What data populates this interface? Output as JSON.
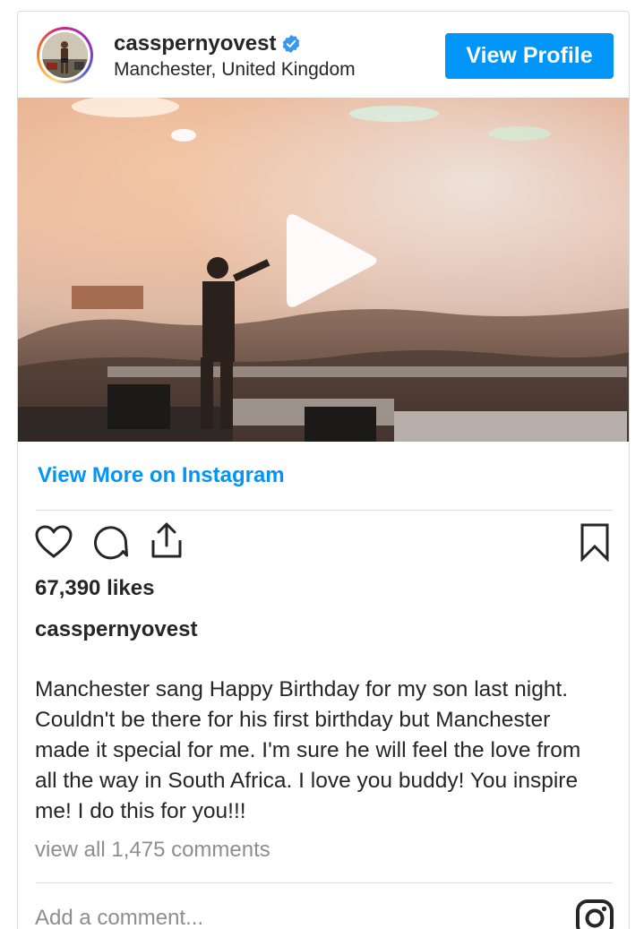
{
  "header": {
    "username": "casspernyovest",
    "verified": true,
    "location": "Manchester, United Kingdom",
    "view_profile_label": "View Profile"
  },
  "media": {
    "type": "video",
    "description_icon": "play-icon"
  },
  "view_more_label": "View More on Instagram",
  "actions": {
    "like_icon": "heart-icon",
    "comment_icon": "comment-icon",
    "share_icon": "share-icon",
    "save_icon": "bookmark-icon"
  },
  "likes_text": "67,390 likes",
  "caption": {
    "username": "casspernyovest",
    "text": "Manchester sang Happy Birthday for my son last night. Couldn't be there for his first birthday but Manchester made it special for me. I'm sure he will feel the love from all the way in South Africa. I love you buddy! You inspire me! I do this for you!!!"
  },
  "view_comments_label": "view all 1,475 comments",
  "comment_input": {
    "placeholder": "Add a comment...",
    "value": ""
  },
  "colors": {
    "accent": "#0095f6",
    "text": "#262626",
    "muted": "#8e8e8e",
    "border": "#dbdbdb"
  }
}
